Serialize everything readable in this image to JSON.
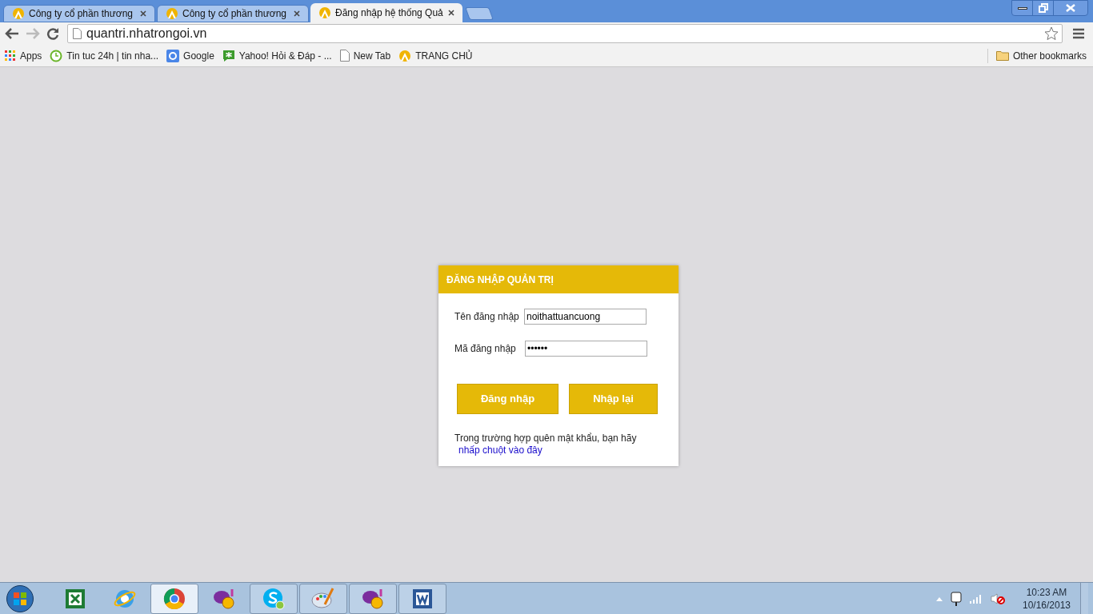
{
  "tabs": [
    {
      "title": "Công ty cổ phần thương",
      "selected": false
    },
    {
      "title": "Công ty cổ phần thương",
      "selected": false
    },
    {
      "title": "Đăng nhập hệ thống Quả",
      "selected": true
    }
  ],
  "address": "quantri.nhatrongoi.vn",
  "bookmarks": [
    {
      "kind": "apps",
      "label": "Apps"
    },
    {
      "kind": "clock",
      "label": "Tin tuc 24h | tin nha..."
    },
    {
      "kind": "google",
      "label": "Google"
    },
    {
      "kind": "yahoo",
      "label": "Yahoo! Hỏi & Đáp - ..."
    },
    {
      "kind": "page",
      "label": "New Tab"
    },
    {
      "kind": "logo",
      "label": "TRANG CHỦ"
    }
  ],
  "other_bookmarks": "Other bookmarks",
  "login": {
    "title": "ĐĂNG NHẬP QUẢN TRỊ",
    "fields": [
      {
        "label": "Tên đăng nhập",
        "value": "noithattuancuong"
      },
      {
        "label": "Mã đăng nhập",
        "value": "••••••"
      }
    ],
    "buttons": [
      "Đăng nhập",
      "Nhập lại"
    ],
    "help_text": "Trong trường hợp quên mật khẩu, bạn hãy",
    "help_link": "nhấp chuột vào đây"
  },
  "taskbar": {
    "apps": [
      {
        "kind": "excel",
        "open": false,
        "active": false
      },
      {
        "kind": "ie",
        "open": false,
        "active": false
      },
      {
        "kind": "chrome",
        "open": true,
        "active": true
      },
      {
        "kind": "yahoo",
        "open": false,
        "active": false
      },
      {
        "kind": "skype",
        "open": true,
        "active": false
      },
      {
        "kind": "paint",
        "open": true,
        "active": false
      },
      {
        "kind": "yahoo",
        "open": true,
        "active": false
      },
      {
        "kind": "word",
        "open": true,
        "active": false
      }
    ],
    "time": "10:23 AM",
    "date": "10/16/2013"
  }
}
